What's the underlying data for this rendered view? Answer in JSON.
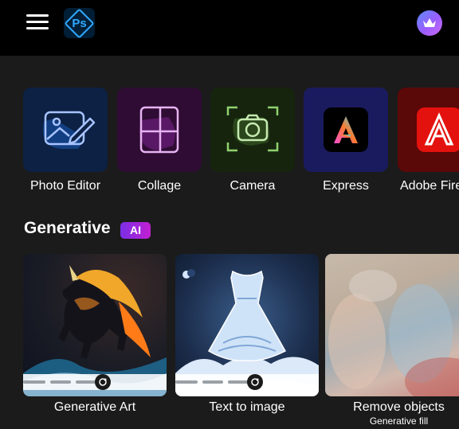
{
  "header": {
    "app_logo_text": "Ps",
    "menu_icon": "hamburger-menu-icon",
    "premium_icon": "crown-icon"
  },
  "tools": [
    {
      "label": "Photo Editor",
      "icon": "photo-edit-icon"
    },
    {
      "label": "Collage",
      "icon": "collage-grid-icon"
    },
    {
      "label": "Camera",
      "icon": "camera-icon"
    },
    {
      "label": "Express",
      "icon": "adobe-express-icon"
    },
    {
      "label": "Adobe Fire",
      "icon": "adobe-firefly-icon"
    }
  ],
  "generative": {
    "title": "Generative",
    "badge": "AI",
    "cards": [
      {
        "label": "Generative Art",
        "sub": ""
      },
      {
        "label": "Text to image",
        "sub": ""
      },
      {
        "label": "Remove objects",
        "sub": "Generative fill"
      }
    ]
  },
  "colors": {
    "background": "#1b1b1b",
    "topbar": "#000000",
    "photoshop_blue": "#31a8ff",
    "ai_badge_start": "#7a2fe6",
    "ai_badge_end": "#c21fd1"
  }
}
